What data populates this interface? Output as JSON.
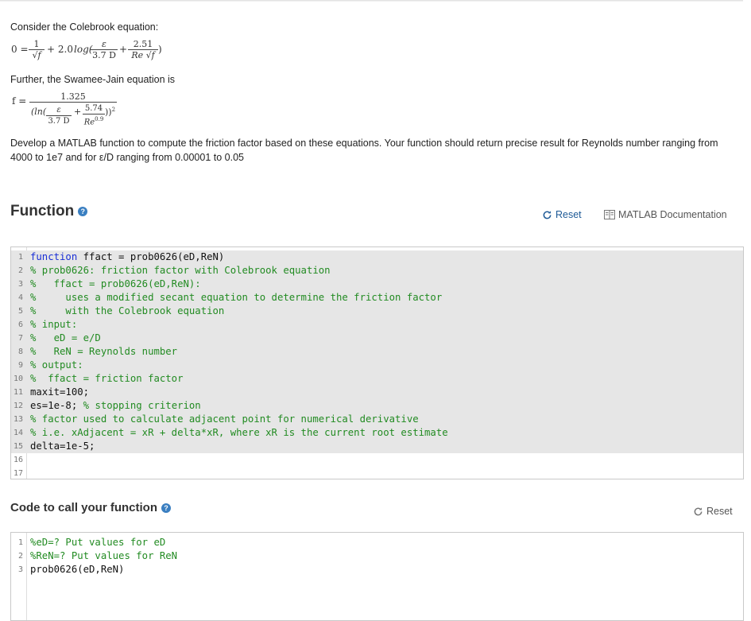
{
  "intro": {
    "p1": "Consider the Colebrook equation:",
    "p2": "Further, the Swamee-Jain equation is",
    "desc": "Develop a MATLAB function to compute the friction factor based on these equations. Your function should return precise result for Reynolds number ranging from 4000 to 1e7 and for ε/D ranging from 0.00001 to 0.05"
  },
  "eq1": {
    "lhs": "0 =",
    "f1_num": "1",
    "f1_den": "√f",
    "mid": "+ 2.0",
    "log": "log(",
    "f2_num": "ε",
    "f2_den": "3.7 D",
    "plus": "+",
    "f3_num": "2.51",
    "f3_den": "Re √f",
    "close": ")"
  },
  "eq2": {
    "lhs": "f =",
    "num": "1.325",
    "ln": "(ln(",
    "f_num": "ε",
    "f_den": "3.7 D",
    "plus": "+",
    "g_num": "5.74",
    "g_den": "Re",
    "g_exp": "0.9",
    "close": "))",
    "sq": "2"
  },
  "function_section": {
    "title": "Function",
    "help": "?",
    "reset": "Reset",
    "doc": "MATLAB Documentation"
  },
  "function_lines": [
    {
      "n": "1",
      "code": "function ffact = prob0626(eD,ReN)",
      "type": "func",
      "locked": true
    },
    {
      "n": "2",
      "code": "% prob0626: friction factor with Colebrook equation",
      "type": "cm",
      "locked": true
    },
    {
      "n": "3",
      "code": "%   ffact = prob0626(eD,ReN):",
      "type": "cm",
      "locked": true
    },
    {
      "n": "4",
      "code": "%     uses a modified secant equation to determine the friction factor",
      "type": "cm",
      "locked": true
    },
    {
      "n": "5",
      "code": "%     with the Colebrook equation",
      "type": "cm",
      "locked": true
    },
    {
      "n": "6",
      "code": "% input:",
      "type": "cm",
      "locked": true
    },
    {
      "n": "7",
      "code": "%   eD = e/D",
      "type": "cm",
      "locked": true
    },
    {
      "n": "8",
      "code": "%   ReN = Reynolds number",
      "type": "cm",
      "locked": true
    },
    {
      "n": "9",
      "code": "% output:",
      "type": "cm",
      "locked": true
    },
    {
      "n": "10",
      "code": "%  ffact = friction factor",
      "type": "cm",
      "locked": true
    },
    {
      "n": "11",
      "code": "maxit=100;",
      "type": "pl",
      "locked": true
    },
    {
      "n": "12",
      "code_pre": "es=1e-8; ",
      "code_cm": "% stopping criterion",
      "type": "mix",
      "locked": true
    },
    {
      "n": "13",
      "code": "% factor used to calculate adjacent point for numerical derivative",
      "type": "cm",
      "locked": true
    },
    {
      "n": "14",
      "code": "% i.e. xAdjacent = xR + delta*xR, where xR is the current root estimate",
      "type": "cm",
      "locked": true
    },
    {
      "n": "15",
      "code": "delta=1e-5;",
      "type": "pl",
      "locked": true
    },
    {
      "n": "16",
      "code": "",
      "type": "pl",
      "locked": false
    },
    {
      "n": "17",
      "code": "",
      "type": "pl",
      "locked": false
    }
  ],
  "call_section": {
    "title": "Code to call your function",
    "help": "?",
    "reset": "Reset"
  },
  "call_lines": [
    {
      "n": "1",
      "code": "%eD=? Put values for eD",
      "type": "cm"
    },
    {
      "n": "2",
      "code": "%ReN=? Put values for ReN",
      "type": "cm"
    },
    {
      "n": "3",
      "code": "prob0626(eD,ReN)",
      "type": "pl"
    }
  ]
}
